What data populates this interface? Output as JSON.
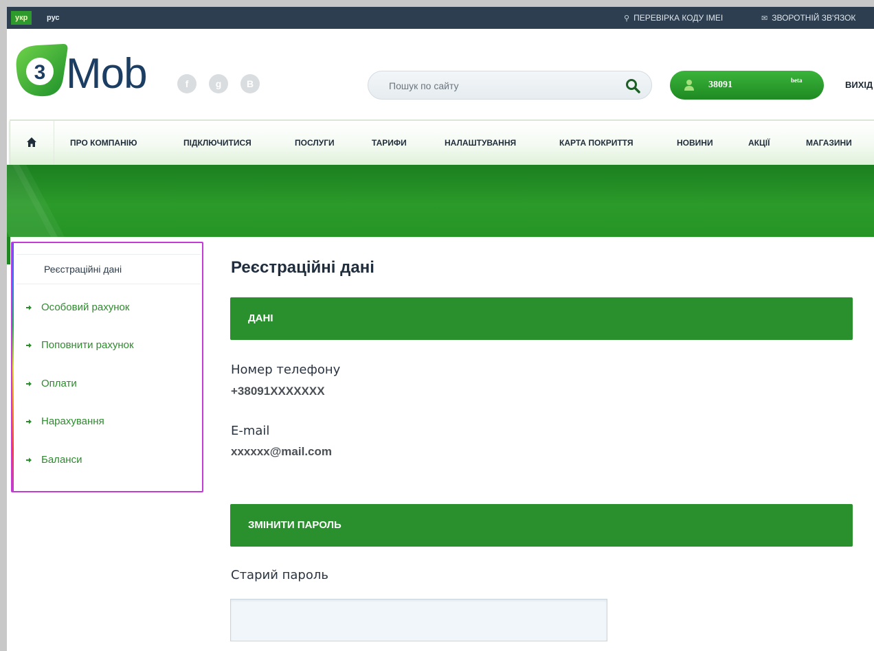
{
  "topbar": {
    "lang_ukr": "укр",
    "lang_rus": "рус",
    "imei_link": "ПЕРЕВІРКА КОДУ IMEI",
    "feedback_link": "ЗВОРОТНІЙ ЗВ'ЯЗОК"
  },
  "header": {
    "logo_digit": "3",
    "logo_text": "Mob",
    "social": {
      "facebook": "f",
      "google": "g",
      "vk": "B"
    },
    "search_placeholder": "Пошук по сайту",
    "account_number": "38091",
    "account_beta": "beta",
    "logout": "ВИХІД"
  },
  "nav": {
    "items": [
      "ПРО КОМПАНІЮ",
      "ПІДКЛЮЧИТИСЯ",
      "ПОСЛУГИ",
      "ТАРИФИ",
      "НАЛАШТУВАННЯ",
      "КАРТА ПОКРИТТЯ",
      "НОВИНИ",
      "АКЦІЇ",
      "МАГАЗИНИ"
    ]
  },
  "sidebar": {
    "current": "Реєстраційні дані",
    "items": [
      "Особовий рахунок",
      "Поповнити рахунок",
      "Оплати",
      "Нарахування",
      "Баланси"
    ]
  },
  "content": {
    "title": "Реєстраційні дані",
    "data_section": "ДАНІ",
    "phone_label": "Номер телефону",
    "phone_value": "+38091XXXXXXX",
    "email_label": "E-mail",
    "email_value": "xxxxxx@mail.com",
    "password_section": "ЗМІНИТИ ПАРОЛЬ",
    "old_password_label": "Старий пароль"
  },
  "colors": {
    "topbar": "#2c3e50",
    "brand_green": "#2a902d",
    "brand_navy": "#1d3e63",
    "link_green": "#2f8a2f"
  }
}
